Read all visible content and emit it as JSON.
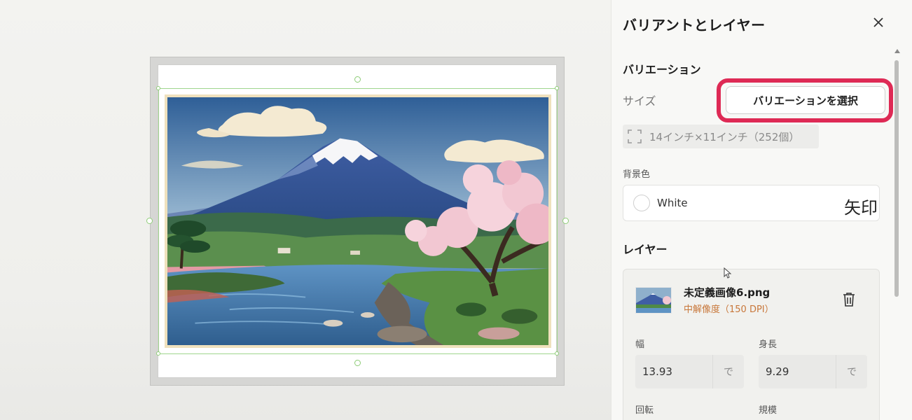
{
  "panel": {
    "title": "バリアントとレイヤー",
    "variation_section": {
      "title": "バリエーション",
      "size_label": "サイズ",
      "select_button": "バリエーションを選択",
      "size_value": "14インチ×11インチ（252個）"
    },
    "background": {
      "label": "背景色",
      "value": "White",
      "arrow_text": "矢印"
    },
    "layers": {
      "title": "レイヤー",
      "item": {
        "name": "未定義画像6.png",
        "resolution": "中解像度（150 DPI）",
        "width_label": "幅",
        "width_value": "13.93",
        "width_unit": "で",
        "height_label": "身長",
        "height_value": "9.29",
        "height_unit": "で",
        "rotation_label": "回転",
        "scale_label": "規模"
      }
    }
  },
  "colors": {
    "accent_highlight": "#de2a55",
    "selection_green": "#9fd58d",
    "resolution_text": "#c8773a"
  },
  "icons": {
    "close": "close-icon",
    "size": "size-frame-icon",
    "delete": "trash-icon"
  }
}
